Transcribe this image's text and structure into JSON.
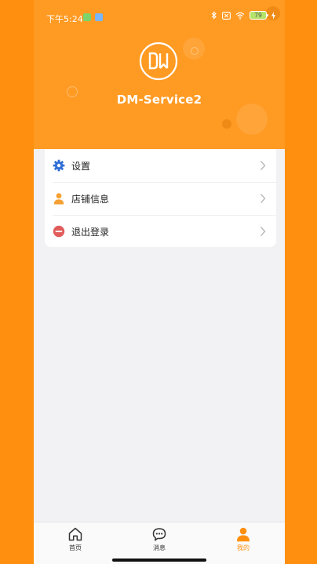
{
  "status_bar": {
    "time": "下午5:24",
    "battery": "79"
  },
  "profile": {
    "logo_icon": "dm-logo-icon",
    "app_name": "DM-Service2"
  },
  "menu": {
    "items": [
      {
        "label": "设置",
        "icon": "gear-icon"
      },
      {
        "label": "店铺信息",
        "icon": "person-icon"
      },
      {
        "label": "退出登录",
        "icon": "logout-icon"
      }
    ]
  },
  "tabbar": {
    "tabs": [
      {
        "label": "首页",
        "icon": "home-icon",
        "active": false
      },
      {
        "label": "消息",
        "icon": "message-icon",
        "active": false
      },
      {
        "label": "我的",
        "icon": "profile-icon",
        "active": true
      }
    ]
  },
  "colors": {
    "accent": "#ff8f0f",
    "header": "#ff9a22",
    "gear": "#2f6fd6",
    "logout": "#e25c5c"
  }
}
